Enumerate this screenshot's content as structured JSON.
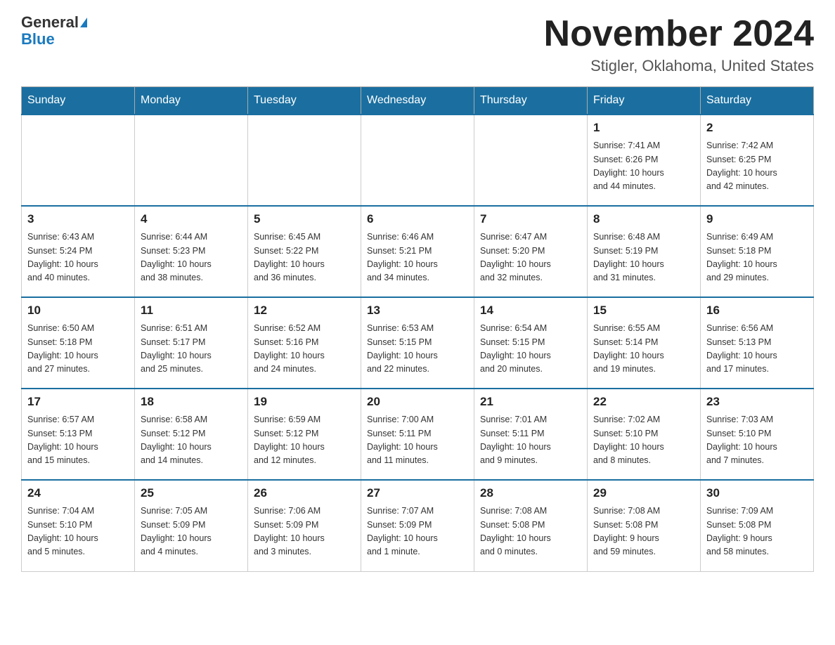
{
  "header": {
    "logo_general": "General",
    "logo_blue": "Blue",
    "month_title": "November 2024",
    "location": "Stigler, Oklahoma, United States"
  },
  "weekdays": [
    "Sunday",
    "Monday",
    "Tuesday",
    "Wednesday",
    "Thursday",
    "Friday",
    "Saturday"
  ],
  "weeks": [
    [
      {
        "day": "",
        "info": ""
      },
      {
        "day": "",
        "info": ""
      },
      {
        "day": "",
        "info": ""
      },
      {
        "day": "",
        "info": ""
      },
      {
        "day": "",
        "info": ""
      },
      {
        "day": "1",
        "info": "Sunrise: 7:41 AM\nSunset: 6:26 PM\nDaylight: 10 hours\nand 44 minutes."
      },
      {
        "day": "2",
        "info": "Sunrise: 7:42 AM\nSunset: 6:25 PM\nDaylight: 10 hours\nand 42 minutes."
      }
    ],
    [
      {
        "day": "3",
        "info": "Sunrise: 6:43 AM\nSunset: 5:24 PM\nDaylight: 10 hours\nand 40 minutes."
      },
      {
        "day": "4",
        "info": "Sunrise: 6:44 AM\nSunset: 5:23 PM\nDaylight: 10 hours\nand 38 minutes."
      },
      {
        "day": "5",
        "info": "Sunrise: 6:45 AM\nSunset: 5:22 PM\nDaylight: 10 hours\nand 36 minutes."
      },
      {
        "day": "6",
        "info": "Sunrise: 6:46 AM\nSunset: 5:21 PM\nDaylight: 10 hours\nand 34 minutes."
      },
      {
        "day": "7",
        "info": "Sunrise: 6:47 AM\nSunset: 5:20 PM\nDaylight: 10 hours\nand 32 minutes."
      },
      {
        "day": "8",
        "info": "Sunrise: 6:48 AM\nSunset: 5:19 PM\nDaylight: 10 hours\nand 31 minutes."
      },
      {
        "day": "9",
        "info": "Sunrise: 6:49 AM\nSunset: 5:18 PM\nDaylight: 10 hours\nand 29 minutes."
      }
    ],
    [
      {
        "day": "10",
        "info": "Sunrise: 6:50 AM\nSunset: 5:18 PM\nDaylight: 10 hours\nand 27 minutes."
      },
      {
        "day": "11",
        "info": "Sunrise: 6:51 AM\nSunset: 5:17 PM\nDaylight: 10 hours\nand 25 minutes."
      },
      {
        "day": "12",
        "info": "Sunrise: 6:52 AM\nSunset: 5:16 PM\nDaylight: 10 hours\nand 24 minutes."
      },
      {
        "day": "13",
        "info": "Sunrise: 6:53 AM\nSunset: 5:15 PM\nDaylight: 10 hours\nand 22 minutes."
      },
      {
        "day": "14",
        "info": "Sunrise: 6:54 AM\nSunset: 5:15 PM\nDaylight: 10 hours\nand 20 minutes."
      },
      {
        "day": "15",
        "info": "Sunrise: 6:55 AM\nSunset: 5:14 PM\nDaylight: 10 hours\nand 19 minutes."
      },
      {
        "day": "16",
        "info": "Sunrise: 6:56 AM\nSunset: 5:13 PM\nDaylight: 10 hours\nand 17 minutes."
      }
    ],
    [
      {
        "day": "17",
        "info": "Sunrise: 6:57 AM\nSunset: 5:13 PM\nDaylight: 10 hours\nand 15 minutes."
      },
      {
        "day": "18",
        "info": "Sunrise: 6:58 AM\nSunset: 5:12 PM\nDaylight: 10 hours\nand 14 minutes."
      },
      {
        "day": "19",
        "info": "Sunrise: 6:59 AM\nSunset: 5:12 PM\nDaylight: 10 hours\nand 12 minutes."
      },
      {
        "day": "20",
        "info": "Sunrise: 7:00 AM\nSunset: 5:11 PM\nDaylight: 10 hours\nand 11 minutes."
      },
      {
        "day": "21",
        "info": "Sunrise: 7:01 AM\nSunset: 5:11 PM\nDaylight: 10 hours\nand 9 minutes."
      },
      {
        "day": "22",
        "info": "Sunrise: 7:02 AM\nSunset: 5:10 PM\nDaylight: 10 hours\nand 8 minutes."
      },
      {
        "day": "23",
        "info": "Sunrise: 7:03 AM\nSunset: 5:10 PM\nDaylight: 10 hours\nand 7 minutes."
      }
    ],
    [
      {
        "day": "24",
        "info": "Sunrise: 7:04 AM\nSunset: 5:10 PM\nDaylight: 10 hours\nand 5 minutes."
      },
      {
        "day": "25",
        "info": "Sunrise: 7:05 AM\nSunset: 5:09 PM\nDaylight: 10 hours\nand 4 minutes."
      },
      {
        "day": "26",
        "info": "Sunrise: 7:06 AM\nSunset: 5:09 PM\nDaylight: 10 hours\nand 3 minutes."
      },
      {
        "day": "27",
        "info": "Sunrise: 7:07 AM\nSunset: 5:09 PM\nDaylight: 10 hours\nand 1 minute."
      },
      {
        "day": "28",
        "info": "Sunrise: 7:08 AM\nSunset: 5:08 PM\nDaylight: 10 hours\nand 0 minutes."
      },
      {
        "day": "29",
        "info": "Sunrise: 7:08 AM\nSunset: 5:08 PM\nDaylight: 9 hours\nand 59 minutes."
      },
      {
        "day": "30",
        "info": "Sunrise: 7:09 AM\nSunset: 5:08 PM\nDaylight: 9 hours\nand 58 minutes."
      }
    ]
  ]
}
